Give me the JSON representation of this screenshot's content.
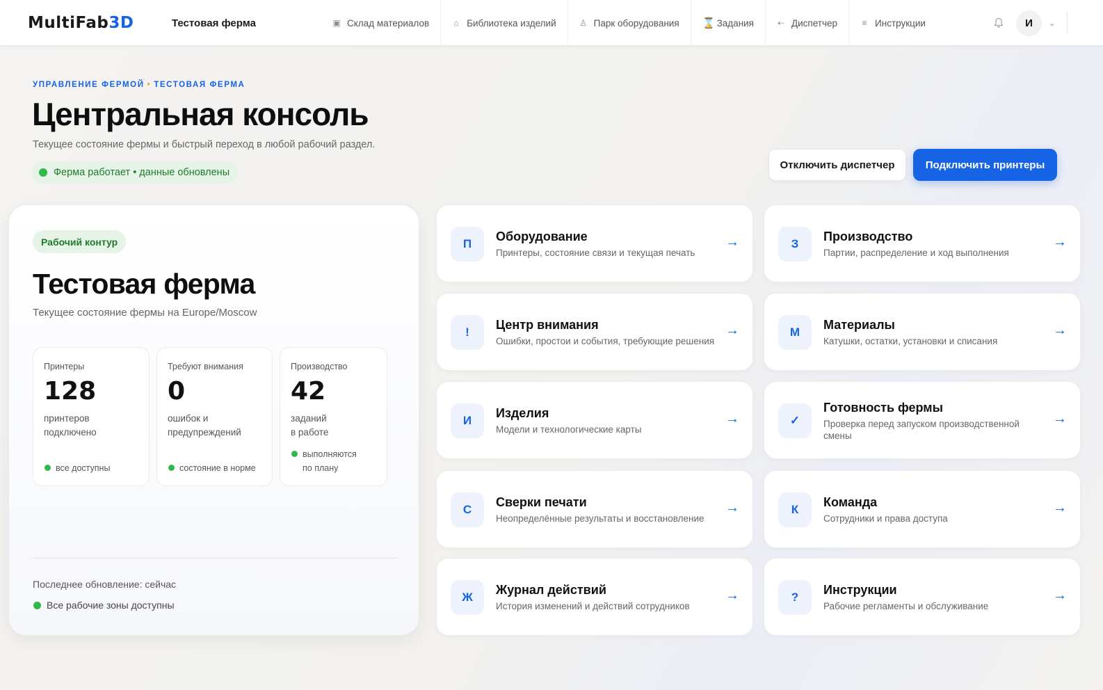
{
  "app": {
    "logo_main": "MultiFab",
    "logo_accent": "3D",
    "farm_name": "Тестовая ферма"
  },
  "nav": [
    {
      "label": "Склад материалов",
      "icon": "warehouse-icon",
      "glyph": "▣"
    },
    {
      "label": "Библиотека изделий",
      "icon": "library-icon",
      "glyph": "⌂"
    },
    {
      "label": "Парк оборудования",
      "icon": "printer-icon",
      "glyph": "♙"
    },
    {
      "label": "Задания",
      "icon": "hourglass-icon",
      "glyph": "⌛"
    },
    {
      "label": "Диспетчер",
      "icon": "dispatcher-icon",
      "glyph": "⇠"
    },
    {
      "label": "Инструкции",
      "icon": "list-icon",
      "glyph": "≡"
    }
  ],
  "user": {
    "avatar_initial": "И"
  },
  "header": {
    "breadcrumb_root": "Управление фермой",
    "breadcrumb_current": "Тестовая ферма",
    "title": "Центральная консоль",
    "subtitle": "Текущее состояние фермы и быстрый переход в любой рабочий раздел.",
    "status": "Ферма работает • данные обновлены",
    "btn_disconnect": "Отключить диспетчер",
    "btn_connect": "Подключить принтеры"
  },
  "farm_panel": {
    "badge": "Рабочий контур",
    "title": "Тестовая ферма",
    "subtitle": "Текущее состояние фермы на Europe/Moscow",
    "stats": [
      {
        "label": "Принтеры",
        "value": "128",
        "desc": "принтеров\nподключено",
        "note": "все доступны"
      },
      {
        "label": "Требуют внимания",
        "value": "0",
        "desc": "ошибок и\nпредупреждений",
        "note": "состояние в норме"
      },
      {
        "label": "Производство",
        "value": "42",
        "desc": "заданий\nв работе",
        "note": "выполняются\nпо плану"
      }
    ],
    "last_update": "Последнее обновление: сейчас",
    "zones": "Все рабочие зоны доступны"
  },
  "cards": [
    {
      "letter": "П",
      "title": "Оборудование",
      "desc": "Принтеры, состояние связи и текущая печать"
    },
    {
      "letter": "З",
      "title": "Производство",
      "desc": "Партии, распределение и ход выполнения"
    },
    {
      "letter": "!",
      "title": "Центр внимания",
      "desc": "Ошибки, простои и события, требующие решения"
    },
    {
      "letter": "М",
      "title": "Материалы",
      "desc": "Катушки, остатки, установки и списания"
    },
    {
      "letter": "И",
      "title": "Изделия",
      "desc": "Модели и технологические карты"
    },
    {
      "letter": "✓",
      "title": "Готовность фермы",
      "desc": "Проверка перед запуском производственной смены"
    },
    {
      "letter": "С",
      "title": "Сверки печати",
      "desc": "Неопределённые результаты и восстановление"
    },
    {
      "letter": "К",
      "title": "Команда",
      "desc": "Сотрудники и права доступа"
    },
    {
      "letter": "Ж",
      "title": "Журнал действий",
      "desc": "История изменений и действий сотрудников"
    },
    {
      "letter": "?",
      "title": "Инструкции",
      "desc": "Рабочие регламенты и обслуживание"
    }
  ],
  "colors": {
    "accent": "#1663e6",
    "success": "#30b84a",
    "success_bg": "#e6f4e7"
  }
}
